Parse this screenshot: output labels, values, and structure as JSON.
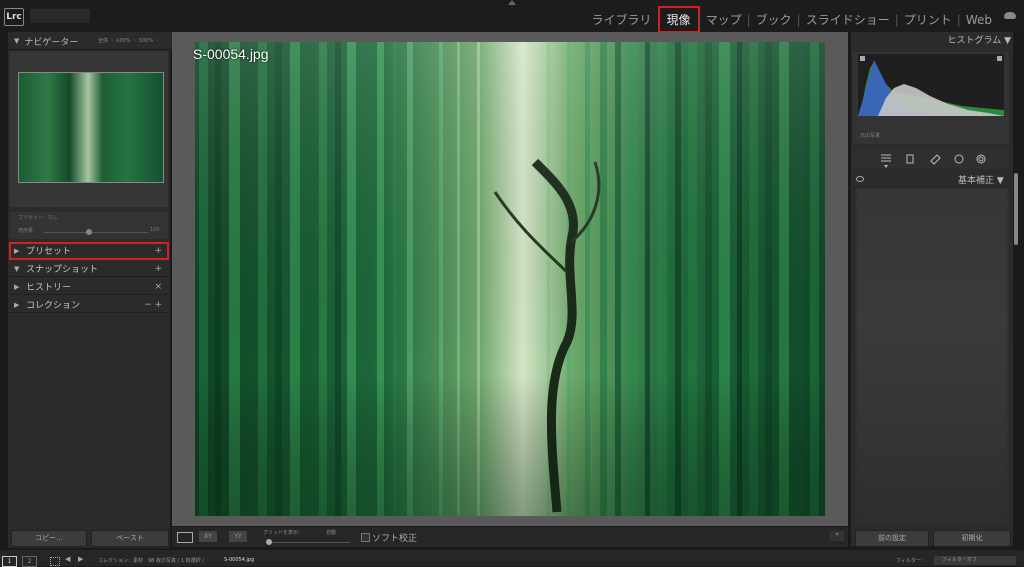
{
  "app": {
    "logo": "Lrc"
  },
  "modules": [
    "ライブラリ",
    "現像",
    "マップ",
    "ブック",
    "スライドショー",
    "プリント",
    "Web"
  ],
  "active_module": "現像",
  "left_panel": {
    "navigator": {
      "label": "ナビゲーター",
      "opts": "全体 ・ 100% ・ 300% ・"
    },
    "preset_preview": {
      "line1": "プリセット：なし",
      "line2": "適用量",
      "value": "100"
    },
    "sections": [
      {
        "label": "プリセット",
        "action": "+"
      },
      {
        "label": "スナップショット",
        "action": "+"
      },
      {
        "label": "ヒストリー",
        "action": "×"
      },
      {
        "label": "コレクション",
        "action": "− +"
      }
    ],
    "copy_label": "コピー...",
    "paste_label": "ペースト"
  },
  "center": {
    "filename": "S-00054.jpg",
    "toolbar": {
      "xy": "XY",
      "yy": "YY",
      "grid_label": "グリッドを表示：",
      "grid_value": "自動",
      "softproof_label": "ソフト校正"
    }
  },
  "right_panel": {
    "histogram_label": "ヒストグラム",
    "orig_photo_label": "元の写真",
    "basic_label": "基本補正",
    "prev_label": "前の設定",
    "reset_label": "初期化"
  },
  "filmstrip": {
    "screen1": "1",
    "screen2": "2",
    "path": "コレクション：素材　98 枚の写真 / 1 枚選択 /",
    "filename": "S-00054.jpg",
    "filter_label": "フィルター：",
    "filter_value": "フィルターオフ"
  },
  "colors": {
    "highlight": "#d42020",
    "panel": "#2b2b2b",
    "workspace": "#5a5a5a"
  }
}
